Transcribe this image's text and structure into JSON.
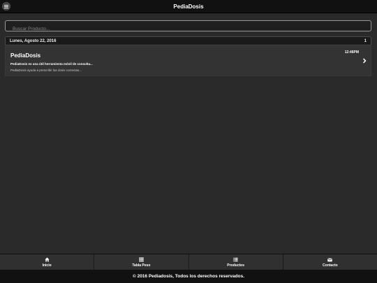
{
  "header": {
    "title": "PediaDosis",
    "menu_icon": "menu-bars-icon"
  },
  "search": {
    "placeholder": "Buscar Producto..."
  },
  "list": {
    "divider": {
      "date": "Lunes, Agosto 22, 2016",
      "count": "1"
    },
    "items": [
      {
        "name": "PediaDosis",
        "time": "12:46PM",
        "summary": "PediaDosis es una útil herramienta móvil de consulta...",
        "detail": "PediaDosis ayuda a prescribir las dosis correctas..."
      }
    ]
  },
  "navbar": {
    "items": [
      {
        "label": "Inicio",
        "icon": "home-icon"
      },
      {
        "label": "Tabla Peso",
        "icon": "grid-icon"
      },
      {
        "label": "Productos",
        "icon": "list-icon"
      },
      {
        "label": "Contacto",
        "icon": "mail-icon"
      }
    ]
  },
  "footer": {
    "text": "© 2016 Pediadosis, Todos los derechos reservados."
  },
  "colors": {
    "header_bg": "#111111",
    "page_bg": "#2a2a2a",
    "item_bg": "#333333"
  }
}
